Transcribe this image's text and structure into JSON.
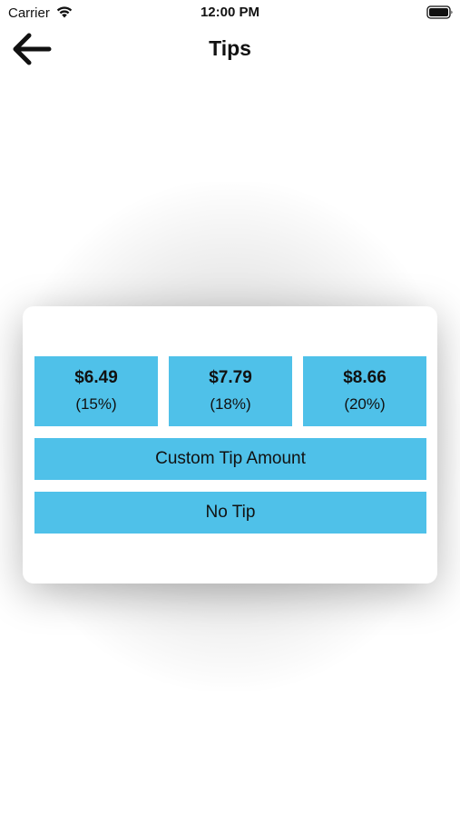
{
  "status_bar": {
    "carrier": "Carrier",
    "time": "12:00 PM",
    "icons": [
      "wifi-icon",
      "battery-icon"
    ]
  },
  "nav": {
    "back_icon": "arrow-left-icon",
    "title": "Tips"
  },
  "tip_options": [
    {
      "amount": "$6.49",
      "percent": "(15%)"
    },
    {
      "amount": "$7.79",
      "percent": "(18%)"
    },
    {
      "amount": "$8.66",
      "percent": "(20%)"
    }
  ],
  "buttons": {
    "custom_tip": "Custom Tip Amount",
    "no_tip": "No Tip"
  },
  "colors": {
    "accent": "#4fc1e9",
    "background": "#ffffff",
    "text": "#111111"
  }
}
